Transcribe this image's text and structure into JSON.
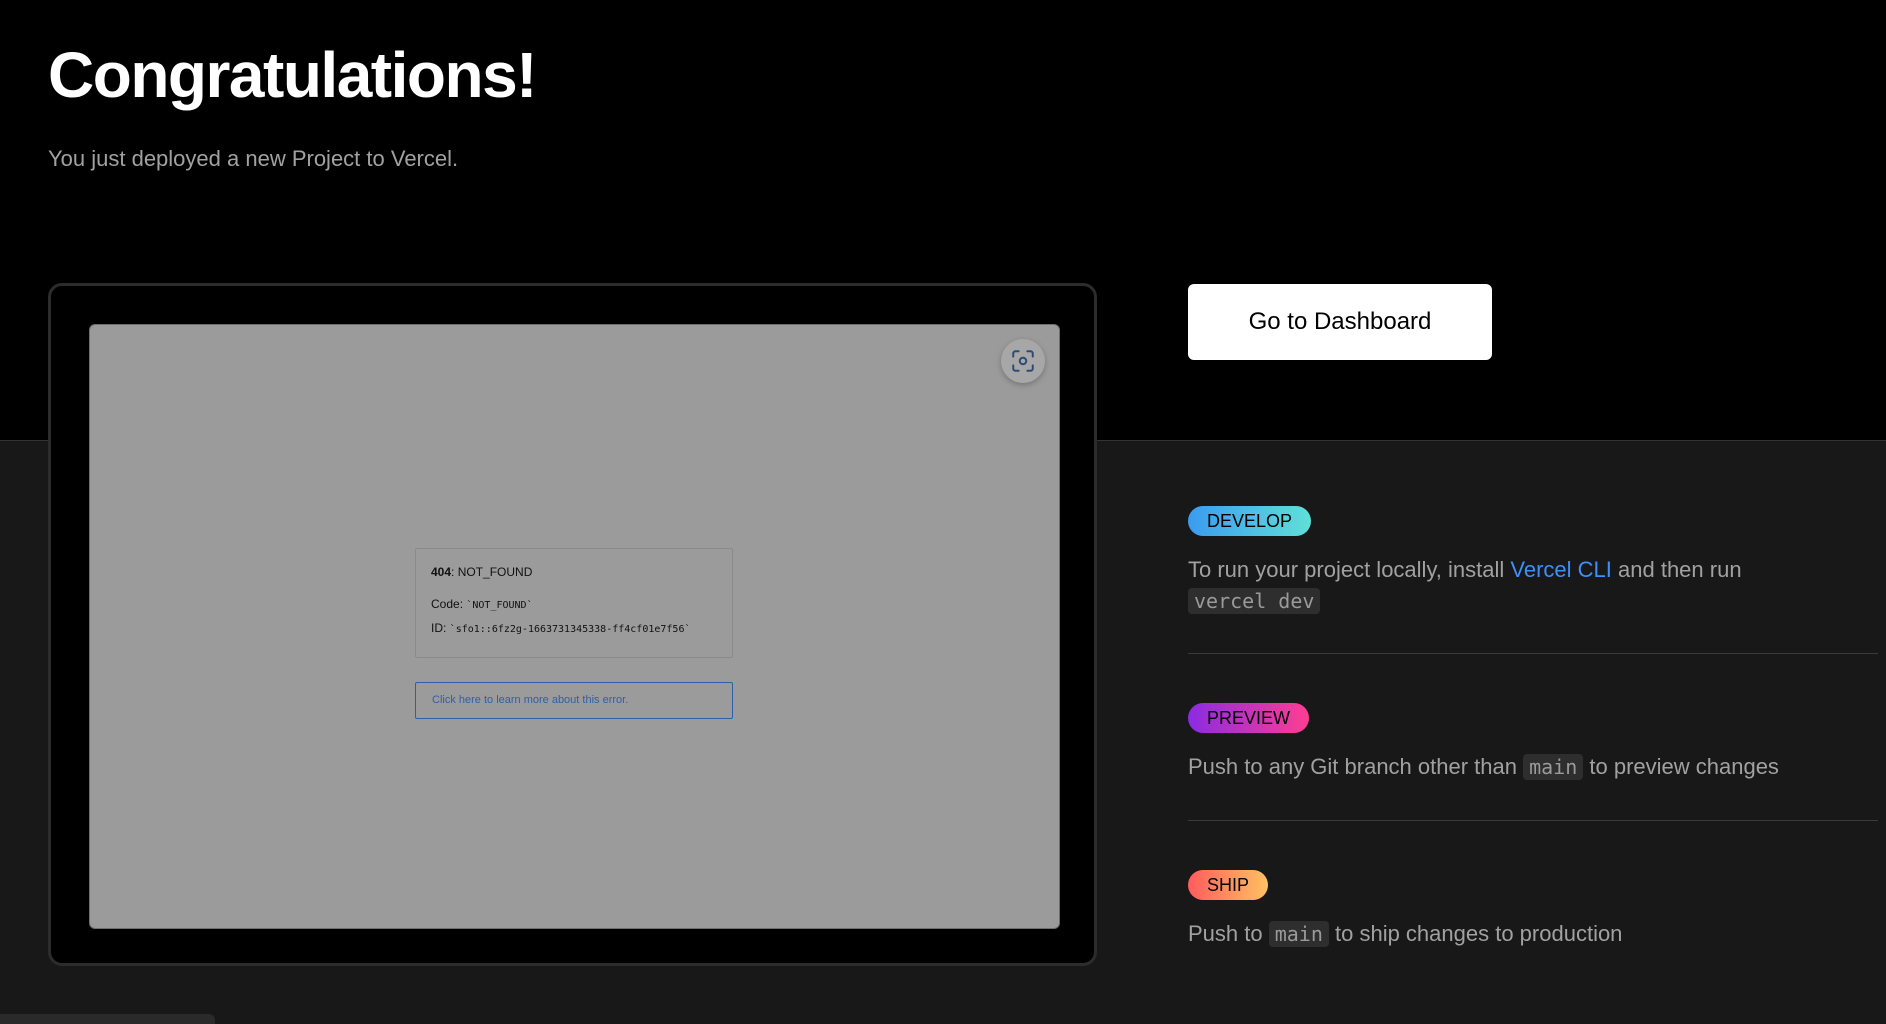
{
  "header": {
    "title": "Congratulations!",
    "subtitle": "You just deployed a new Project to Vercel."
  },
  "preview": {
    "screenshot_icon": "screenshot-icon",
    "error": {
      "status_code": "404",
      "status_text": ": NOT_FOUND",
      "code_label": "Code: ",
      "code_value": "`NOT_FOUND`",
      "id_label": "ID: ",
      "id_value": "`sfo1::6fz2g-1663731345338-ff4cf01e7f56`",
      "link_text": "Click here to learn more about this error."
    }
  },
  "actions": {
    "dashboard_label": "Go to Dashboard"
  },
  "steps": [
    {
      "badge": "DEVELOP",
      "text_before": "To run your project locally, install ",
      "link": "Vercel CLI",
      "text_after": " and then run ",
      "code": "vercel dev"
    },
    {
      "badge": "PREVIEW",
      "text_before": "Push to any Git branch other than ",
      "code": "main",
      "text_after": " to preview changes"
    },
    {
      "badge": "SHIP",
      "text_before": "Push to ",
      "code": "main",
      "text_after": " to ship changes to production"
    }
  ],
  "colors": {
    "develop_gradient": [
      "#3b9bf0",
      "#5fe0d8"
    ],
    "preview_gradient": [
      "#8a2be2",
      "#ff3d91"
    ],
    "ship_gradient": [
      "#ff5c5c",
      "#ffc163"
    ],
    "link": "#3e8ff7"
  }
}
